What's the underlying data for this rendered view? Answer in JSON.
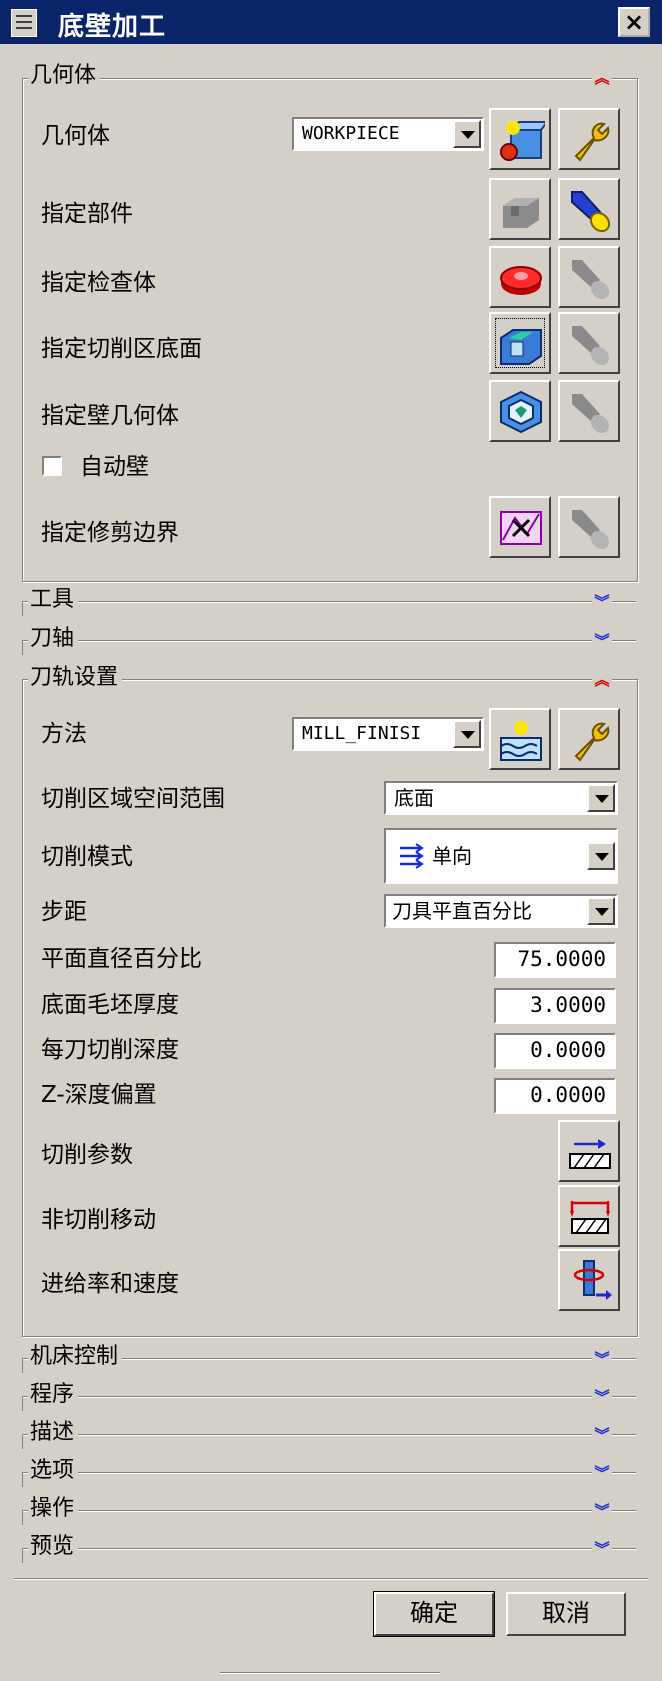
{
  "window": {
    "title": "底壁加工",
    "close_label": "×"
  },
  "geometry_group": {
    "title": "几何体",
    "geometry_label": "几何体",
    "geometry_value": "WORKPIECE",
    "specify_part": "指定部件",
    "specify_check": "指定检查体",
    "specify_cut_floor": "指定切削区底面",
    "specify_wall": "指定壁几何体",
    "auto_wall": "自动壁",
    "auto_wall_checked": false,
    "specify_trim": "指定修剪边界"
  },
  "tool_group": {
    "title": "工具"
  },
  "axis_group": {
    "title": "刀轴"
  },
  "path_group": {
    "title": "刀轨设置",
    "method_label": "方法",
    "method_value": "MILL_FINISI",
    "cut_region_label": "切削区域空间范围",
    "cut_region_value": "底面",
    "cut_pattern_label": "切削模式",
    "cut_pattern_value": "单向",
    "stepover_label": "步距",
    "stepover_value": "刀具平直百分比",
    "plane_diameter_label": "平面直径百分比",
    "plane_diameter_value": "75.0000",
    "floor_stock_label": "底面毛坯厚度",
    "floor_stock_value": "3.0000",
    "depth_per_cut_label": "每刀切削深度",
    "depth_per_cut_value": "0.0000",
    "z_offset_label": "Z-深度偏置",
    "z_offset_value": "0.0000",
    "cut_params_label": "切削参数",
    "non_cut_label": "非切削移动",
    "feeds_label": "进给率和速度"
  },
  "collapsed_groups": {
    "machine": "机床控制",
    "program": "程序",
    "description": "描述",
    "options": "选项",
    "actions": "操作",
    "preview": "预览"
  },
  "footer": {
    "ok": "确定",
    "cancel": "取消"
  },
  "chevrons": {
    "expanded": "︽",
    "collapsed": "︾"
  },
  "colors": {
    "title_bar": "#0a246a",
    "dialog_bg": "#d4d0c8",
    "chevron_up": "#d40000",
    "chevron_down": "#1b2bd1"
  }
}
